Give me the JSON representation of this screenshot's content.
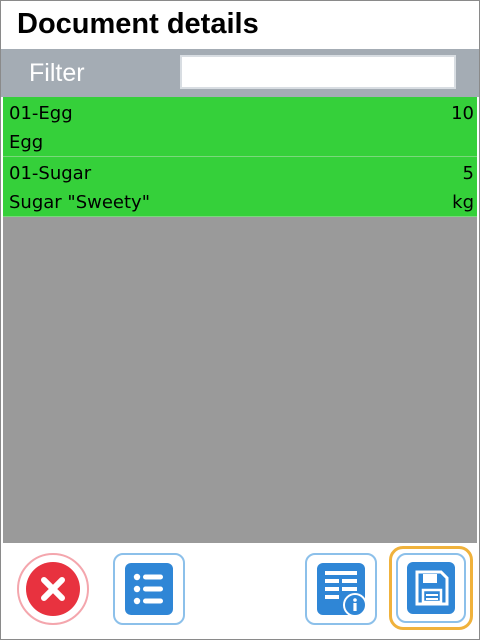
{
  "header": {
    "title": "Document details"
  },
  "filter": {
    "label": "Filter",
    "value": "",
    "placeholder": ""
  },
  "items": [
    {
      "code": "01-Egg",
      "quantity": "10",
      "name": "Egg",
      "unit": ""
    },
    {
      "code": "01-Sugar",
      "quantity": "5",
      "name": "Sugar \"Sweety\"",
      "unit": "kg"
    }
  ],
  "toolbar": {
    "buttons": [
      {
        "id": "cancel",
        "icon": "close-icon"
      },
      {
        "id": "list",
        "icon": "list-icon"
      },
      {
        "id": "info",
        "icon": "document-info-icon"
      },
      {
        "id": "save",
        "icon": "floppy-disk-icon"
      }
    ]
  },
  "colors": {
    "row_green": "#35d03a",
    "list_background": "#9a9a9a",
    "filter_bar": "#a4acb4",
    "cancel_red": "#e8323f",
    "icon_blue": "#2f86d6",
    "focus_orange": "#f0b23c"
  }
}
